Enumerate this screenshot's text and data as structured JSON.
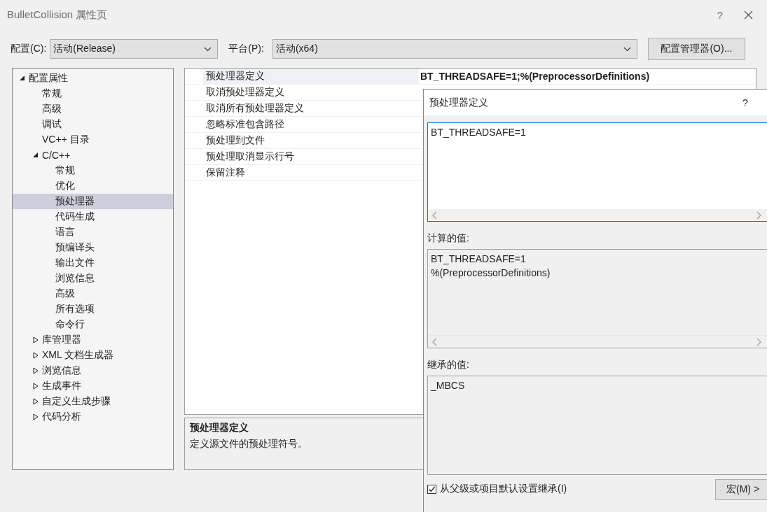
{
  "window": {
    "title": "BulletCollision 属性页",
    "help": "?"
  },
  "config": {
    "label": "配置(C):",
    "value": "活动(Release)"
  },
  "platform": {
    "label": "平台(P):",
    "value": "活动(x64)"
  },
  "config_manager_button": "配置管理器(O)...",
  "tree": [
    {
      "label": "配置属性",
      "expanded": true,
      "selected": false,
      "children": [
        {
          "label": "常规",
          "selected": false
        },
        {
          "label": "高级",
          "selected": false
        },
        {
          "label": "调试",
          "selected": false
        },
        {
          "label": "VC++ 目录",
          "selected": false
        },
        {
          "label": "C/C++",
          "expanded": true,
          "selected": false,
          "children": [
            {
              "label": "常规",
              "selected": false
            },
            {
              "label": "优化",
              "selected": false
            },
            {
              "label": "预处理器",
              "selected": true
            },
            {
              "label": "代码生成",
              "selected": false
            },
            {
              "label": "语言",
              "selected": false
            },
            {
              "label": "预编译头",
              "selected": false
            },
            {
              "label": "输出文件",
              "selected": false
            },
            {
              "label": "浏览信息",
              "selected": false
            },
            {
              "label": "高级",
              "selected": false
            },
            {
              "label": "所有选项",
              "selected": false
            },
            {
              "label": "命令行",
              "selected": false
            }
          ]
        },
        {
          "label": "库管理器",
          "expanded": false,
          "selected": false
        },
        {
          "label": "XML 文档生成器",
          "expanded": false,
          "selected": false
        },
        {
          "label": "浏览信息",
          "expanded": false,
          "selected": false
        },
        {
          "label": "生成事件",
          "expanded": false,
          "selected": false
        },
        {
          "label": "自定义生成步骤",
          "expanded": false,
          "selected": false
        },
        {
          "label": "代码分析",
          "expanded": false,
          "selected": false
        }
      ]
    }
  ],
  "properties": [
    {
      "name": "预处理器定义",
      "value": "BT_THREADSAFE=1;%(PreprocessorDefinitions)",
      "modified": true,
      "selected": true
    },
    {
      "name": "取消预处理器定义",
      "selected": false
    },
    {
      "name": "取消所有预处理器定义",
      "selected": false
    },
    {
      "name": "忽略标准包含路径",
      "selected": false
    },
    {
      "name": "预处理到文件",
      "selected": false
    },
    {
      "name": "预处理取消显示行号",
      "selected": false
    },
    {
      "name": "保留注释",
      "selected": false
    }
  ],
  "description": {
    "title": "预处理器定义",
    "text": "定义源文件的预处理符号。"
  },
  "dialog": {
    "title": "预处理器定义",
    "help": "?",
    "value": "BT_THREADSAFE=1",
    "evaluated_label": "计算的值:",
    "evaluated_lines": [
      "BT_THREADSAFE=1",
      "%(PreprocessorDefinitions)"
    ],
    "inherited_label": "继承的值:",
    "inherited_lines": [
      "_MBCS"
    ],
    "inherit_checkbox": {
      "label": "从父级或项目默认设置继承(I)",
      "checked": true
    },
    "macros_button": "宏(M) >"
  }
}
